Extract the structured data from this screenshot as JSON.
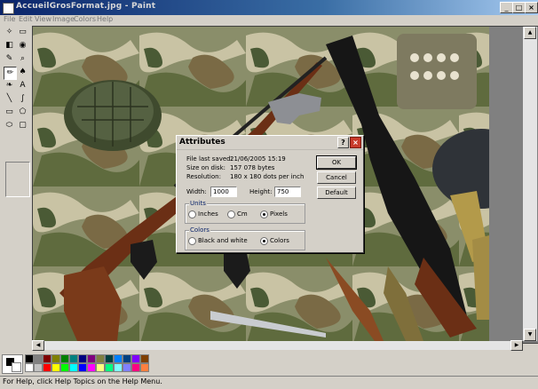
{
  "window": {
    "title": "AccueilGrosFormat.jpg - Paint",
    "controls": {
      "minimize": "_",
      "maximize": "□",
      "close": "×"
    }
  },
  "menu": [
    "File",
    "Edit",
    "View",
    "Image",
    "Colors",
    "Help"
  ],
  "tools": [
    {
      "name": "free-form-select-icon",
      "glyph": "✧"
    },
    {
      "name": "select-icon",
      "glyph": "▭"
    },
    {
      "name": "eraser-icon",
      "glyph": "◧"
    },
    {
      "name": "fill-icon",
      "glyph": "◉"
    },
    {
      "name": "pick-color-icon",
      "glyph": "✎"
    },
    {
      "name": "magnifier-icon",
      "glyph": "⌕"
    },
    {
      "name": "pencil-icon",
      "glyph": "✏"
    },
    {
      "name": "brush-icon",
      "glyph": "♠"
    },
    {
      "name": "airbrush-icon",
      "glyph": "❧"
    },
    {
      "name": "text-icon",
      "glyph": "A"
    },
    {
      "name": "line-icon",
      "glyph": "╲"
    },
    {
      "name": "curve-icon",
      "glyph": "∫"
    },
    {
      "name": "rectangle-icon",
      "glyph": "▭"
    },
    {
      "name": "polygon-icon",
      "glyph": "⬠"
    },
    {
      "name": "ellipse-icon",
      "glyph": "⬭"
    },
    {
      "name": "rounded-rectangle-icon",
      "glyph": "▢"
    }
  ],
  "palette": {
    "top": [
      "#000000",
      "#808080",
      "#800000",
      "#808000",
      "#008000",
      "#008080",
      "#000080",
      "#800080",
      "#808040",
      "#004040",
      "#0080ff",
      "#004080",
      "#8000ff",
      "#804000"
    ],
    "bottom": [
      "#ffffff",
      "#c0c0c0",
      "#ff0000",
      "#ffff00",
      "#00ff00",
      "#00ffff",
      "#0000ff",
      "#ff00ff",
      "#ffff80",
      "#00ff80",
      "#80ffff",
      "#8080ff",
      "#ff0080",
      "#ff8040"
    ]
  },
  "status": "For Help, click Help Topics on the Help Menu.",
  "dialog": {
    "title": "Attributes",
    "help_glyph": "?",
    "close_glyph": "×",
    "file_last_saved_label": "File last saved:",
    "file_last_saved_value": "21/06/2005 15:19",
    "size_on_disk_label": "Size on disk:",
    "size_on_disk_value": "157 078 bytes",
    "resolution_label": "Resolution:",
    "resolution_value": "180 x 180 dots per inch",
    "width_label": "Width:",
    "width_value": "1000",
    "height_label": "Height:",
    "height_value": "750",
    "units_title": "Units",
    "units": {
      "inches": "Inches",
      "cm": "Cm",
      "pixels": "Pixels",
      "selected": "Pixels"
    },
    "colors_title": "Colors",
    "colors": {
      "bw": "Black and white",
      "colors": "Colors",
      "selected": "Colors"
    },
    "ok_label": "OK",
    "cancel_label": "Cancel",
    "default_label": "Default"
  }
}
